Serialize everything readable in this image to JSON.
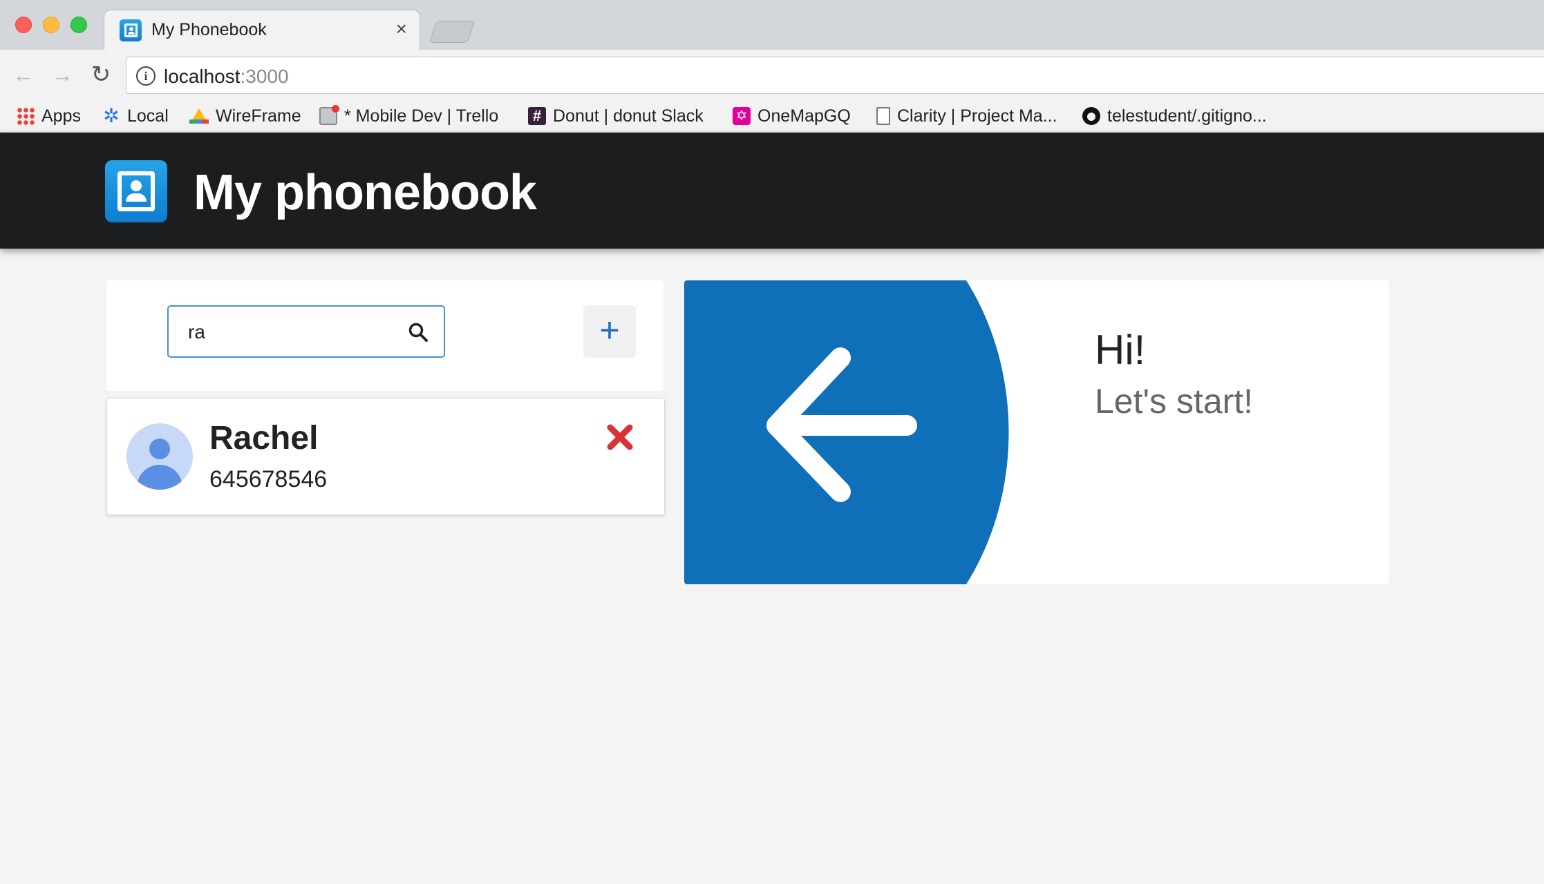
{
  "browser": {
    "tab_title": "My Phonebook",
    "tab_close": "×",
    "url_host": "localhost",
    "url_port": ":3000",
    "bookmarks": [
      {
        "label": "Apps",
        "icon": "apps-grid-icon"
      },
      {
        "label": "Local",
        "icon": "gear-icon"
      },
      {
        "label": "WireFrame",
        "icon": "google-drive-icon"
      },
      {
        "label": "* Mobile Dev | Trello",
        "icon": "trello-icon"
      },
      {
        "label": "Donut | donut Slack",
        "icon": "slack-hash-icon"
      },
      {
        "label": "OneMapGQ",
        "icon": "graphql-icon"
      },
      {
        "label": "Clarity | Project Ma...",
        "icon": "document-icon"
      },
      {
        "label": "telestudent/.gitigno...",
        "icon": "github-icon"
      }
    ]
  },
  "header": {
    "title": "My phonebook"
  },
  "search": {
    "value": "ra"
  },
  "contacts": [
    {
      "name": "Rachel",
      "phone": "645678546"
    }
  ],
  "welcome": {
    "greeting": "Hi!",
    "subtitle": "Let's start!"
  },
  "colors": {
    "accent": "#0f6fb8",
    "header_bg": "#1c1d1f",
    "delete": "#d63333"
  }
}
